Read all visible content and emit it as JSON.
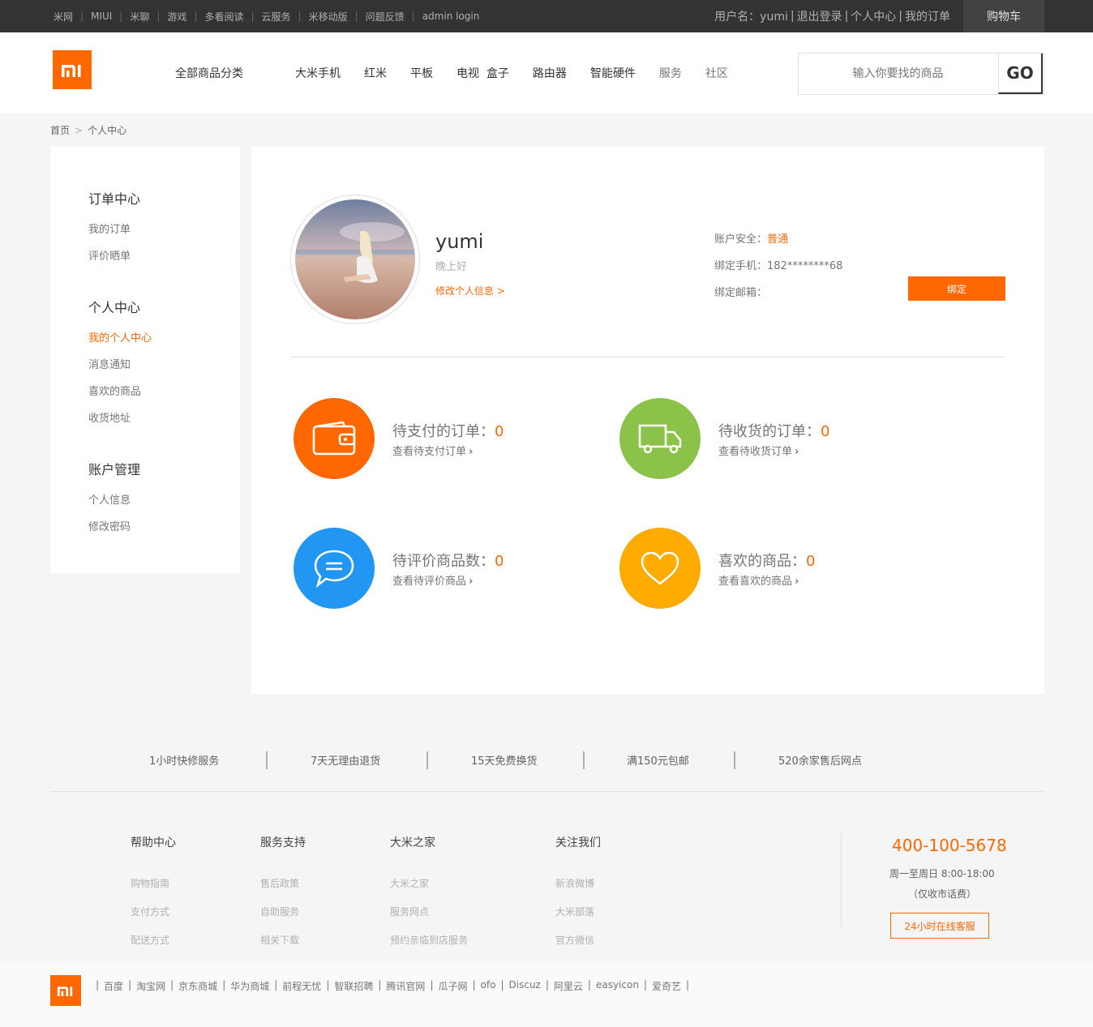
{
  "topbar": {
    "links": [
      "米网",
      "MIUI",
      "米聊",
      "游戏",
      "多看阅读",
      "云服务",
      "米移动版",
      "问题反馈",
      "admin login"
    ],
    "user_label": "用户名：yumi",
    "logout": "退出登录",
    "center": "个人中心",
    "orders": "我的订单",
    "cart": "购物车"
  },
  "header": {
    "logo_text": "mi",
    "all_categories": "全部商品分类",
    "nav": [
      "大米手机",
      "红米",
      "平板",
      "电视  盒子",
      "路由器",
      "智能硬件",
      "服务",
      "社区"
    ],
    "search_placeholder": "输入你要找的商品",
    "search_button": "GO"
  },
  "breadcrumb": {
    "home": "首页",
    "separator": ">",
    "current": "个人中心"
  },
  "sidebar": {
    "groups": [
      {
        "title": "订单中心",
        "items": [
          "我的订单",
          "评价晒单"
        ]
      },
      {
        "title": "个人中心",
        "items": [
          "我的个人中心",
          "消息通知",
          "喜欢的商品",
          "收货地址"
        ],
        "active_index": 0
      },
      {
        "title": "账户管理",
        "items": [
          "个人信息",
          "修改密码"
        ]
      }
    ]
  },
  "profile": {
    "username": "yumi",
    "greeting": "晚上好",
    "edit_link": "修改个人信息 >",
    "security_label": "账户安全：",
    "security_value": "普通",
    "phone_label": "绑定手机：182********68",
    "email_label": "绑定邮箱：",
    "bind_button": "绑定"
  },
  "stats": [
    {
      "title": "待支付的订单：",
      "count": "0",
      "link": "查看待支付订单",
      "color": "#ff6700",
      "icon": "wallet-icon"
    },
    {
      "title": "待收货的订单：",
      "count": "0",
      "link": "查看待收货订单",
      "color": "#8bc34a",
      "icon": "truck-icon"
    },
    {
      "title": "待评价商品数：",
      "count": "0",
      "link": "查看待评价商品",
      "color": "#2196f3",
      "icon": "comment-icon"
    },
    {
      "title": "喜欢的商品：",
      "count": "0",
      "link": "查看喜欢的商品",
      "color": "#ffab00",
      "icon": "heart-icon"
    }
  ],
  "services": [
    "1小时快修服务",
    "7天无理由退货",
    "15天免费换货",
    "满150元包邮",
    "520余家售后网点"
  ],
  "footer_columns": [
    {
      "title": "帮助中心",
      "links": [
        "购物指南",
        "支付方式",
        "配送方式"
      ]
    },
    {
      "title": "服务支持",
      "links": [
        "售后政策",
        "自助服务",
        "相关下载"
      ]
    },
    {
      "title": "大米之家",
      "links": [
        "大米之家",
        "服务网点",
        "预约亲临到店服务"
      ]
    },
    {
      "title": "关注我们",
      "links": [
        "新浪微博",
        "大米部落",
        "官方微信"
      ]
    }
  ],
  "contact": {
    "phone": "400-100-5678",
    "hours": "周一至周日 8:00-18:00",
    "fee": "（仅收市话费）",
    "online_button": "24小时在线客服"
  },
  "bottom_links": [
    "百度",
    "淘宝网",
    "京东商城",
    "华为商城",
    "前程无忧",
    "智联招聘",
    "腾讯官网",
    "瓜子网",
    "ofo",
    "Discuz",
    "阿里云",
    "easyicon",
    "爱奇艺"
  ],
  "colors": {
    "accent": "#ff6700",
    "topbar": "#333333"
  }
}
